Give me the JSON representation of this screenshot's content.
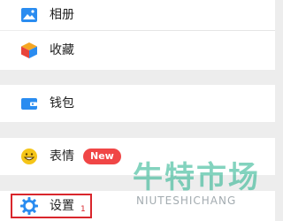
{
  "menu": {
    "album": {
      "label": "相册",
      "icon": "image-icon"
    },
    "favorites": {
      "label": "收藏",
      "icon": "cube-icon"
    },
    "wallet": {
      "label": "钱包",
      "icon": "wallet-icon"
    },
    "stickers": {
      "label": "表情",
      "icon": "smiley-icon",
      "badge": "New"
    },
    "settings": {
      "label": "设置",
      "icon": "gear-icon",
      "step": "1"
    }
  },
  "watermark": {
    "text_cn": "牛特市场",
    "text_en": "NIUTESHICHANG"
  },
  "colors": {
    "accent_blue": "#2a8cf0",
    "badge_red": "#f04646",
    "highlight_red": "#d9262c",
    "smiley_yellow": "#f5c518",
    "watermark_green": "#1fb08a"
  }
}
